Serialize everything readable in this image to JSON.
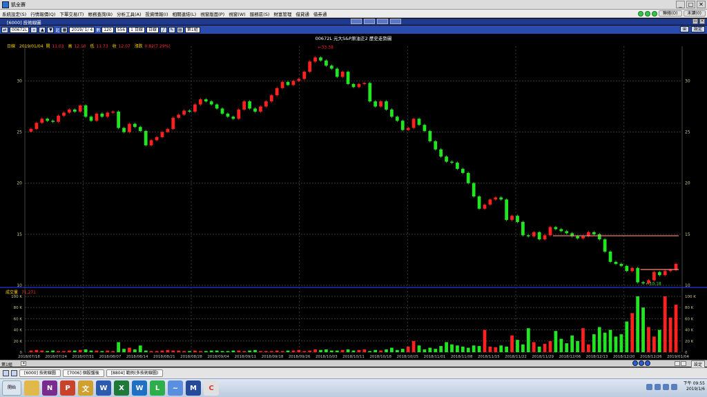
{
  "window": {
    "title": "凱全賽",
    "min": "_",
    "max": "□",
    "close": "✕"
  },
  "menu": {
    "items": [
      "系統設定(S)",
      "行情報價(Q)",
      "下單交易(T)",
      "帳務查詢(B)",
      "分析工具(A)",
      "投資情報(I)",
      "相關連結(L)",
      "視窗版面(P)",
      "視窗(W)",
      "服務區(S)",
      "財富管理",
      "借貸通",
      "借券通"
    ],
    "chat_label": "聯絡(O)",
    "close_all_label": "未讀(0)"
  },
  "chart_window": {
    "title": "[6000] 技術線圖",
    "settings_label": "設定"
  },
  "toolbar": {
    "symbol": "00672L",
    "range_label": "起",
    "date": "2019/ 1/ 4",
    "count_label": "數",
    "count": "120",
    "count2": "556",
    "interval": "1 日線",
    "period": "日線",
    "page": "第1組",
    "settings_label": "設定"
  },
  "chart": {
    "title": "00672L 元大S&P原油正2 歷史走勢圖",
    "info": {
      "tf": "日線",
      "date": "2019/01/04",
      "open_label": "開",
      "open": "11.03",
      "high_label": "高",
      "high": "12.10",
      "low_label": "低",
      "low": "11.73",
      "close_label": "收",
      "close": "12.07",
      "chg_label": "漲跌",
      "chg": "0.82(7.29%)"
    },
    "price_ticks": [
      "30",
      "25",
      "20",
      "15",
      "10"
    ],
    "vol_label": "成交量",
    "vol_value": "71,271",
    "vol_ticks": [
      "100 K",
      "80 K",
      "60 K",
      "40 K",
      "20 K",
      "0"
    ],
    "date_ticks": [
      "2018/07/18",
      "2018/07/24",
      "2018/07/31",
      "2018/08/07",
      "2018/08/14",
      "2018/08/21",
      "2018/08/28",
      "2018/09/04",
      "2018/09/11",
      "2018/09/18",
      "2018/09/26",
      "2018/10/03",
      "2018/10/11",
      "2018/10/18",
      "2018/10/25",
      "2018/11/01",
      "2018/11/08",
      "2018/11/15",
      "2018/11/22",
      "2018/11/29",
      "2018/12/06",
      "2018/12/13",
      "2018/12/20",
      "2018/12/26",
      "2019/01/04"
    ],
    "high_mark": "33.38",
    "low_mark": "10.18",
    "colors": {
      "up": "#ff2020",
      "down": "#22e522",
      "bg": "#000000",
      "axis": "#c8c89a"
    }
  },
  "chart_data": {
    "type": "bar",
    "title": "00672L 元大S&P原油正2 歷史走勢圖",
    "price_ylim": [
      10,
      33.4
    ],
    "volume_ylim": [
      0,
      100
    ],
    "closes": [
      25.3,
      25.9,
      26.3,
      26.1,
      26.0,
      26.6,
      26.9,
      27.2,
      27.0,
      27.6,
      26.5,
      26.1,
      26.8,
      26.5,
      26.9,
      27.0,
      25.4,
      25.0,
      25.8,
      25.5,
      25.1,
      23.7,
      24.2,
      24.5,
      25.0,
      25.3,
      26.4,
      26.7,
      27.1,
      27.0,
      27.7,
      28.2,
      28.0,
      27.7,
      27.3,
      26.8,
      26.5,
      26.3,
      27.2,
      28.0,
      27.3,
      27.0,
      27.5,
      28.0,
      28.6,
      29.3,
      29.9,
      29.6,
      30.0,
      30.2,
      30.9,
      31.9,
      32.3,
      32.0,
      31.5,
      31.2,
      30.4,
      30.9,
      29.7,
      29.4,
      29.7,
      29.8,
      28.0,
      27.5,
      28.0,
      27.2,
      26.5,
      26.1,
      25.2,
      25.4,
      26.3,
      25.7,
      25.1,
      24.1,
      23.3,
      22.6,
      22.1,
      22.0,
      21.4,
      21.0,
      20.0,
      18.7,
      17.5,
      17.9,
      18.4,
      18.6,
      18.4,
      16.4,
      16.8,
      16.2,
      14.9,
      14.8,
      15.2,
      14.5,
      14.9,
      15.7,
      15.5,
      15.3,
      15.1,
      14.8,
      14.6,
      14.8,
      15.2,
      15.0,
      14.5,
      13.3,
      12.3,
      12.1,
      11.9,
      11.4,
      11.7,
      10.3,
      10.2,
      10.5,
      11.3,
      11.0,
      11.4,
      11.5,
      12.1
    ],
    "volumes": [
      3,
      4,
      3,
      2,
      3,
      2,
      2,
      3,
      3,
      4,
      5,
      3,
      3,
      2,
      3,
      2,
      18,
      6,
      8,
      5,
      12,
      3,
      2,
      2,
      3,
      4,
      3,
      3,
      2,
      2,
      3,
      2,
      2,
      3,
      3,
      2,
      2,
      3,
      3,
      2,
      3,
      4,
      2,
      2,
      2,
      3,
      2,
      3,
      3,
      4,
      2,
      3,
      5,
      4,
      5,
      3,
      3,
      4,
      5,
      3,
      4,
      5,
      2,
      4,
      3,
      5,
      8,
      4,
      6,
      10,
      20,
      12,
      5,
      8,
      6,
      11,
      18,
      14,
      12,
      10,
      8,
      12,
      11,
      40,
      10,
      9,
      12,
      10,
      30,
      22,
      14,
      43,
      18,
      10,
      15,
      20,
      38,
      24,
      16,
      30,
      20,
      43,
      14,
      32,
      45,
      35,
      40,
      28,
      32,
      55,
      70,
      100,
      80,
      45,
      28,
      40,
      100,
      62,
      85,
      48,
      45,
      72
    ]
  },
  "status": {
    "page": "第1組",
    "settings_label": "設定"
  },
  "tabs": [
    "[6000] 技術線圖",
    "[7006] 個股盤後",
    "[8804] 範例(多技術線圖)"
  ],
  "taskbar": {
    "start": "開始",
    "time": "下午 09:55",
    "date": "2019/1/6",
    "apps": [
      "資料夾",
      "N",
      "P",
      "文",
      "W",
      "X",
      "W",
      "L",
      "~",
      "M",
      "C"
    ]
  }
}
